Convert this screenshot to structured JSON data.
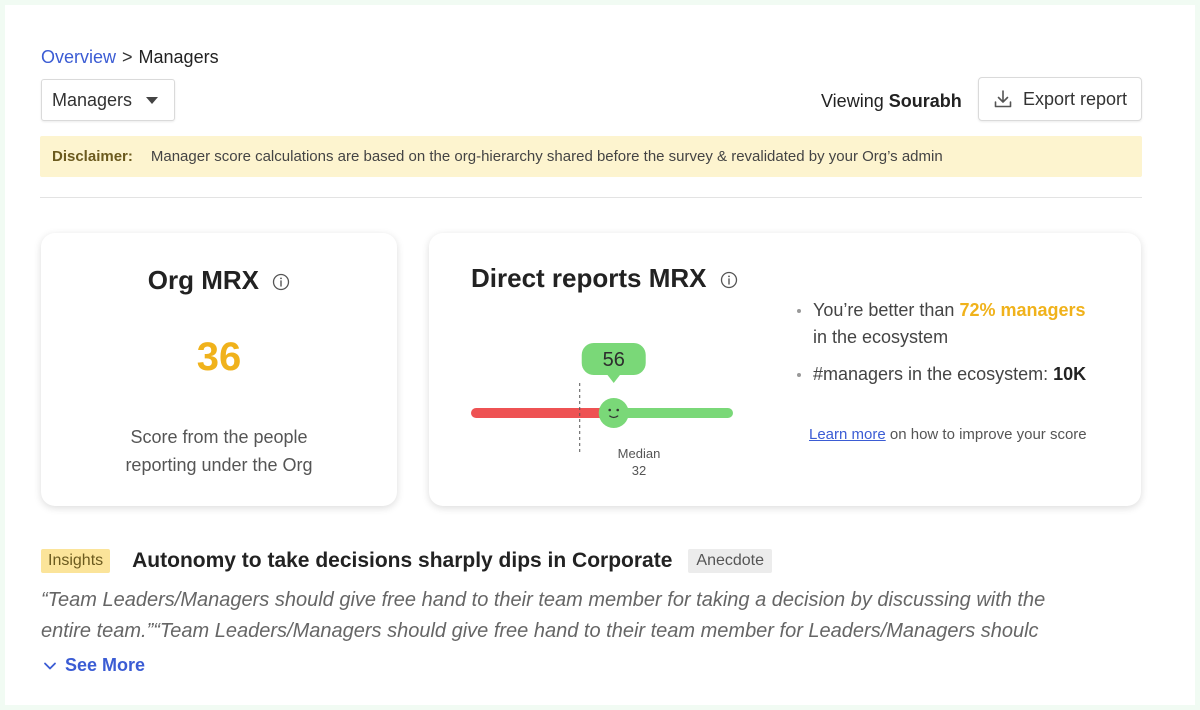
{
  "breadcrumb": {
    "parent": "Overview",
    "separator": ">",
    "current": "Managers"
  },
  "filter": {
    "selected": "Managers"
  },
  "viewing": {
    "prefix": "Viewing",
    "name": "Sourabh"
  },
  "export": {
    "label": "Export report",
    "icon": "download-icon"
  },
  "disclaimer": {
    "label": "Disclaimer:",
    "text": "Manager score calculations are based on the org-hierarchy shared before the survey & revalidated by your Org’s admin"
  },
  "org_card": {
    "title": "Org MRX",
    "score": "36",
    "description": "Score from the people reporting under the Org"
  },
  "direct_card": {
    "title": "Direct reports MRX",
    "score": "56",
    "median_label": "Median",
    "median_value": "32",
    "gauge": {
      "value": 56,
      "median": 32,
      "min": 0,
      "max": 100,
      "colors": {
        "red": "#ee5253",
        "yellow": "#f8de8a",
        "green": "#7ad878"
      }
    },
    "stat1": {
      "pre": "You’re better than ",
      "highlight": "72% managers",
      "post": "in the ecosystem"
    },
    "stat2": {
      "pre": "#managers in the ecosystem: ",
      "value": "10K"
    },
    "learn": {
      "link": "Learn more",
      "rest": " on how to improve your score"
    }
  },
  "insights": {
    "tag": "Insights",
    "title": "Autonomy to take decisions sharply dips in Corporate",
    "category": "Anecdote",
    "quote_line1": "“Team Leaders/Managers should give free hand to their team member for taking a decision by discussing with the",
    "quote_line2": "entire team.”“Team Leaders/Managers should give free hand to their team member for Leaders/Managers shoulc",
    "see_more": "See More"
  },
  "colors": {
    "accent_blue": "#3b5cd4",
    "score_yellow": "#f0b21b",
    "disclaimer_bg": "#fdf4cf"
  }
}
